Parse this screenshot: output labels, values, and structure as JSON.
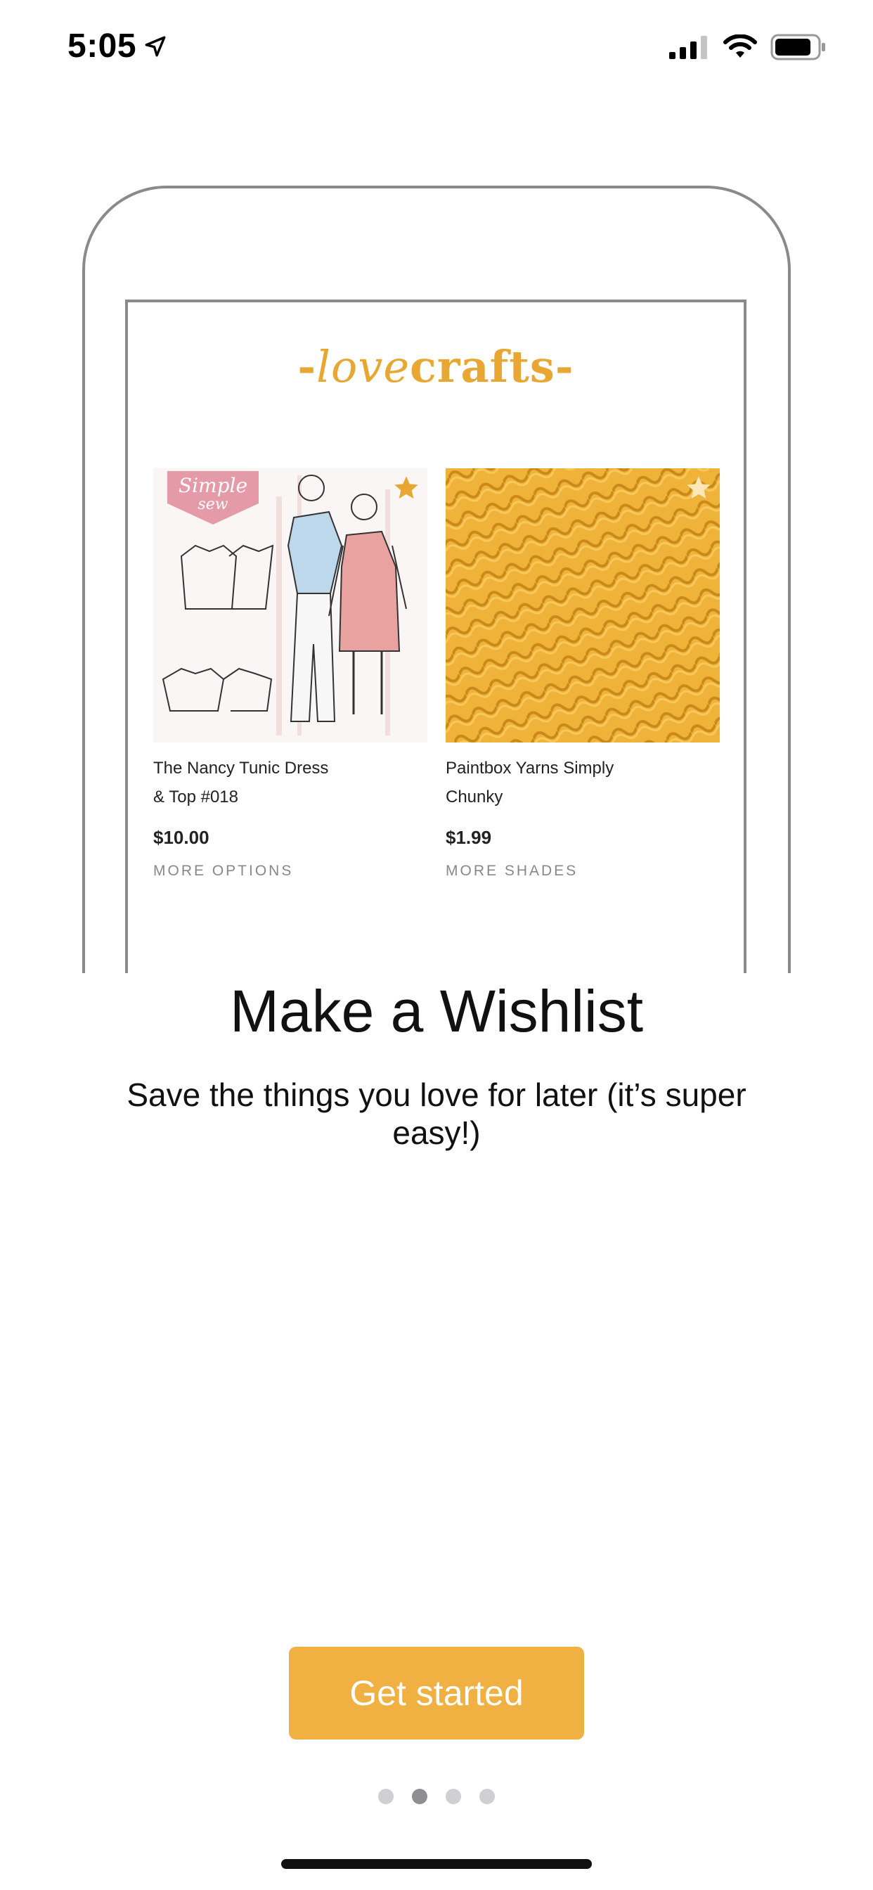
{
  "status_bar": {
    "time": "5:05",
    "icons": [
      "location-arrow-icon",
      "cellular-signal-icon",
      "wifi-icon",
      "battery-icon"
    ]
  },
  "illustration": {
    "brand": {
      "prefix": "-",
      "script": "love",
      "bold": "crafts",
      "suffix": "-",
      "color": "#e8a733"
    },
    "products": [
      {
        "title_line1": "The Nancy Tunic Dress",
        "title_line2": "& Top #018",
        "price": "$10.00",
        "more": "MORE OPTIONS",
        "badge_line1": "Simple",
        "badge_line2": "sew",
        "favorite": "star-icon"
      },
      {
        "title_line1": "Paintbox Yarns Simply",
        "title_line2": "Chunky",
        "price": "$1.99",
        "more": "MORE SHADES",
        "favorite": "star-icon"
      }
    ]
  },
  "onboarding": {
    "title": "Make a Wishlist",
    "subtitle": "Save the things you love for later (it’s super easy!)",
    "cta_label": "Get started",
    "cta_color": "#f0b042",
    "page_count": 4,
    "active_page": 2
  }
}
